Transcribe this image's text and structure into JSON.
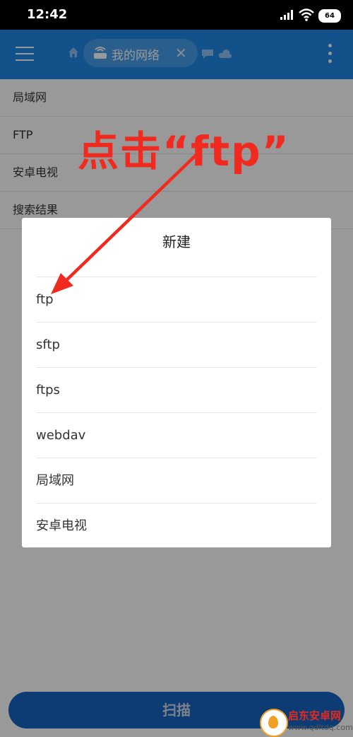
{
  "status_bar": {
    "time": "12:42",
    "battery": "64"
  },
  "app_bar": {
    "network_chip_label": "我的网络",
    "close_glyph": "✕",
    "accent": "#1e88e5"
  },
  "list": {
    "items": [
      "局域网",
      "FTP",
      "安卓电视",
      "搜索结果"
    ]
  },
  "dialog": {
    "title": "新建",
    "options": [
      "ftp",
      "sftp",
      "ftps",
      "webdav",
      "局域网",
      "安卓电视"
    ]
  },
  "scan_button": {
    "label": "扫描"
  },
  "annotation": {
    "text": "点击“ftp”",
    "color": "#f12a20"
  },
  "watermark": {
    "title": "启东安卓网",
    "url": "www.qdltdq.com"
  }
}
